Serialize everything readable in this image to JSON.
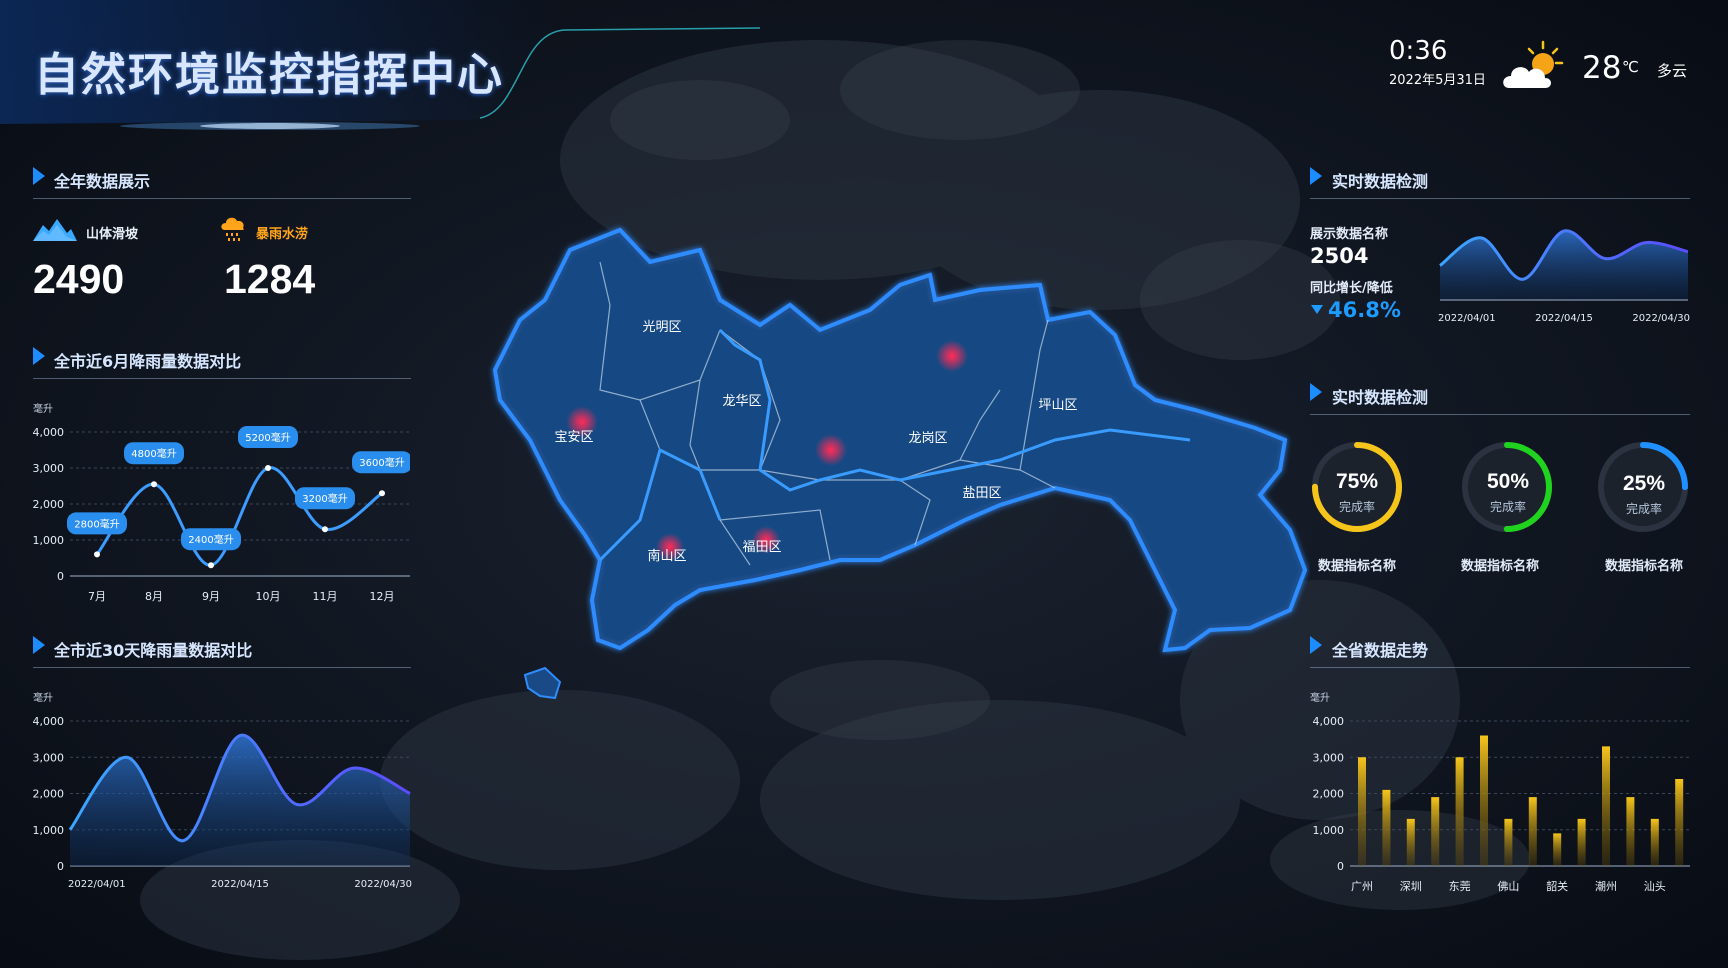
{
  "header": {
    "title": "自然环境监控指挥中心",
    "time": "0:36",
    "date": "2022年5月31日",
    "temperature": "28",
    "temp_unit": "℃",
    "weather": "多云",
    "weather_icon": "partly-cloudy-icon"
  },
  "left": {
    "annual": {
      "title": "全年数据展示",
      "items": [
        {
          "label": "山体滑坡",
          "value": "2490",
          "icon": "mountain-icon",
          "color": "#3aa8ff"
        },
        {
          "label": "暴雨水涝",
          "value": "1284",
          "icon": "rain-cloud-icon",
          "color": "#ffa41b"
        }
      ]
    },
    "six_month": {
      "title": "全市近6月降雨量数据对比",
      "unit": "毫升"
    },
    "thirty_day": {
      "title": "全市近30天降雨量数据对比",
      "unit": "毫升"
    }
  },
  "right": {
    "realtime": {
      "title": "实时数据检测",
      "name_label": "展示数据名称",
      "value": "2504",
      "change_label": "同比增长/降低",
      "change": "46.8%"
    },
    "rings": {
      "title": "实时数据检测",
      "items": [
        {
          "pct": "75%",
          "value": 75,
          "sub": "完成率",
          "name": "数据指标名称",
          "color": "#f6c51c"
        },
        {
          "pct": "50%",
          "value": 50,
          "sub": "完成率",
          "name": "数据指标名称",
          "color": "#1fd31f"
        },
        {
          "pct": "25%",
          "value": 25,
          "sub": "完成率",
          "name": "数据指标名称",
          "color": "#1e90ff"
        }
      ]
    },
    "province": {
      "title": "全省数据走势",
      "unit": "毫升"
    }
  },
  "map": {
    "districts": [
      {
        "name": "光明区"
      },
      {
        "name": "宝安区"
      },
      {
        "name": "龙华区"
      },
      {
        "name": "龙岗区"
      },
      {
        "name": "坪山区"
      },
      {
        "name": "盐田区"
      },
      {
        "name": "南山区"
      },
      {
        "name": "福田区"
      }
    ]
  },
  "chart_data": [
    {
      "id": "six_month",
      "type": "line",
      "ylabel": "毫升",
      "categories": [
        "7月",
        "8月",
        "9月",
        "10月",
        "11月",
        "12月"
      ],
      "values": [
        600,
        2550,
        300,
        3000,
        1300,
        2300
      ],
      "labels": [
        "2800毫升",
        "4800毫升",
        "2400毫升",
        "5200毫升",
        "3200毫升",
        "3600毫升"
      ],
      "y_ticks": [
        "0",
        "1,000",
        "2,000",
        "3,000",
        "4,000"
      ],
      "ylim": [
        0,
        4000
      ]
    },
    {
      "id": "thirty_day",
      "type": "area",
      "ylabel": "毫升",
      "x_ticks": [
        "2022/04/01",
        "2022/04/15",
        "2022/04/30"
      ],
      "x": [
        0,
        5,
        10,
        15,
        20,
        25,
        30
      ],
      "values": [
        1000,
        3000,
        700,
        3600,
        1700,
        2700,
        2000
      ],
      "y_ticks": [
        "0",
        "1,000",
        "2,000",
        "3,000",
        "4,000"
      ],
      "ylim": [
        0,
        4000
      ]
    },
    {
      "id": "realtime_spark",
      "type": "area",
      "x_ticks": [
        "2022/04/01",
        "2022/04/15",
        "2022/04/30"
      ],
      "x": [
        0,
        5,
        10,
        15,
        20,
        25,
        30
      ],
      "values": [
        1500,
        2700,
        900,
        3000,
        1800,
        2500,
        2100
      ],
      "ylim": [
        0,
        4000
      ]
    },
    {
      "id": "province",
      "type": "bar",
      "ylabel": "毫升",
      "x_ticks": [
        "广州",
        "深圳",
        "东莞",
        "佛山",
        "韶关",
        "潮州",
        "汕头"
      ],
      "values": [
        3000,
        2100,
        1300,
        1900,
        3000,
        3600,
        1300,
        1900,
        900,
        1300,
        3300,
        1900,
        1300,
        2400
      ],
      "y_ticks": [
        "0",
        "1,000",
        "2,000",
        "3,000",
        "4,000"
      ],
      "ylim": [
        0,
        4000
      ]
    }
  ]
}
